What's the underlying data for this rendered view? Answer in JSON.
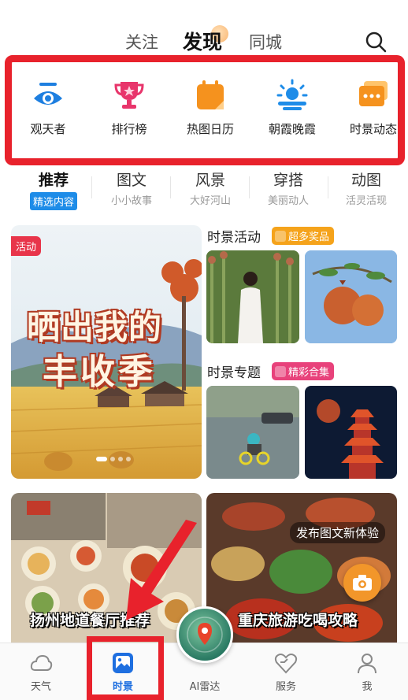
{
  "top_tabs": {
    "follow": "关注",
    "discover": "发现",
    "city": "同城"
  },
  "quick_entries": [
    {
      "label": "观天者",
      "icon": "eye-icon",
      "color": "#1e7fe0"
    },
    {
      "label": "排行榜",
      "icon": "trophy-icon",
      "color": "#e8356b"
    },
    {
      "label": "热图日历",
      "icon": "calendar-icon",
      "color": "#f5921e"
    },
    {
      "label": "朝霞晚霞",
      "icon": "sunrise-icon",
      "color": "#1e8ce8"
    },
    {
      "label": "时景动态",
      "icon": "chat-cards-icon",
      "color": "#f5921e"
    }
  ],
  "categories": [
    {
      "title": "推荐",
      "sub": "精选内容"
    },
    {
      "title": "图文",
      "sub": "小小故事"
    },
    {
      "title": "风景",
      "sub": "大好河山"
    },
    {
      "title": "穿搭",
      "sub": "美丽动人"
    },
    {
      "title": "动图",
      "sub": "活灵活现"
    }
  ],
  "banner": {
    "badge": "活动",
    "line1": "晒出我的",
    "line2": "丰收季"
  },
  "sections": {
    "activity": {
      "title": "时景活动",
      "tag": "超多奖品"
    },
    "topic": {
      "title": "时景专题",
      "tag": "精彩合集"
    }
  },
  "feed_cards": [
    {
      "caption": "扬州地道餐厅推荐"
    },
    {
      "caption": "重庆旅游吃喝攻略"
    }
  ],
  "publish_hint": "发布图文新体验",
  "bottom_nav": [
    {
      "label": "天气",
      "icon": "cloud-icon"
    },
    {
      "label": "时景",
      "icon": "picture-icon"
    },
    {
      "label": "AI雷达",
      "icon": "radar-icon"
    },
    {
      "label": "服务",
      "icon": "service-icon"
    },
    {
      "label": "我",
      "icon": "person-icon"
    }
  ],
  "colors": {
    "highlight_red": "#e8222c",
    "accent_blue": "#1e8ce8",
    "accent_orange": "#f5a31b"
  }
}
